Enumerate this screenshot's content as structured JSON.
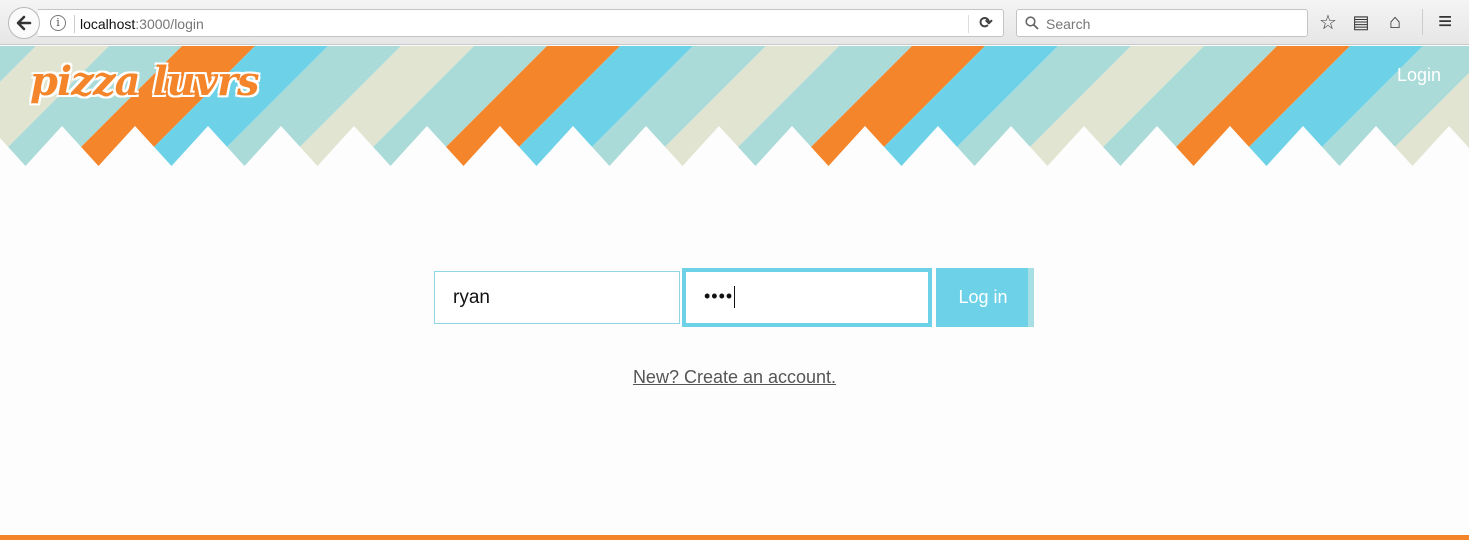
{
  "browser": {
    "url_host": "localhost",
    "url_path": ":3000/login",
    "search_placeholder": "Search",
    "info_glyph": "i",
    "reload_glyph": "⟳",
    "bookmark_glyph": "☆",
    "reader_glyph": "▤",
    "home_glyph": "⌂",
    "menu_glyph": "≡"
  },
  "header": {
    "logo_text": "pizza luvrs",
    "nav_login": "Login",
    "stripe_colors": [
      "#abdbd9",
      "#f4852a",
      "#6dd2e8",
      "#abdbd9",
      "#e1e4d0"
    ]
  },
  "login_form": {
    "username_value": "ryan",
    "password_mask": "••••",
    "submit_label": "Log in"
  },
  "create_account_link": "New? Create an account.",
  "colors": {
    "accent": "#6dd2e8",
    "brand_orange": "#f4852a"
  }
}
